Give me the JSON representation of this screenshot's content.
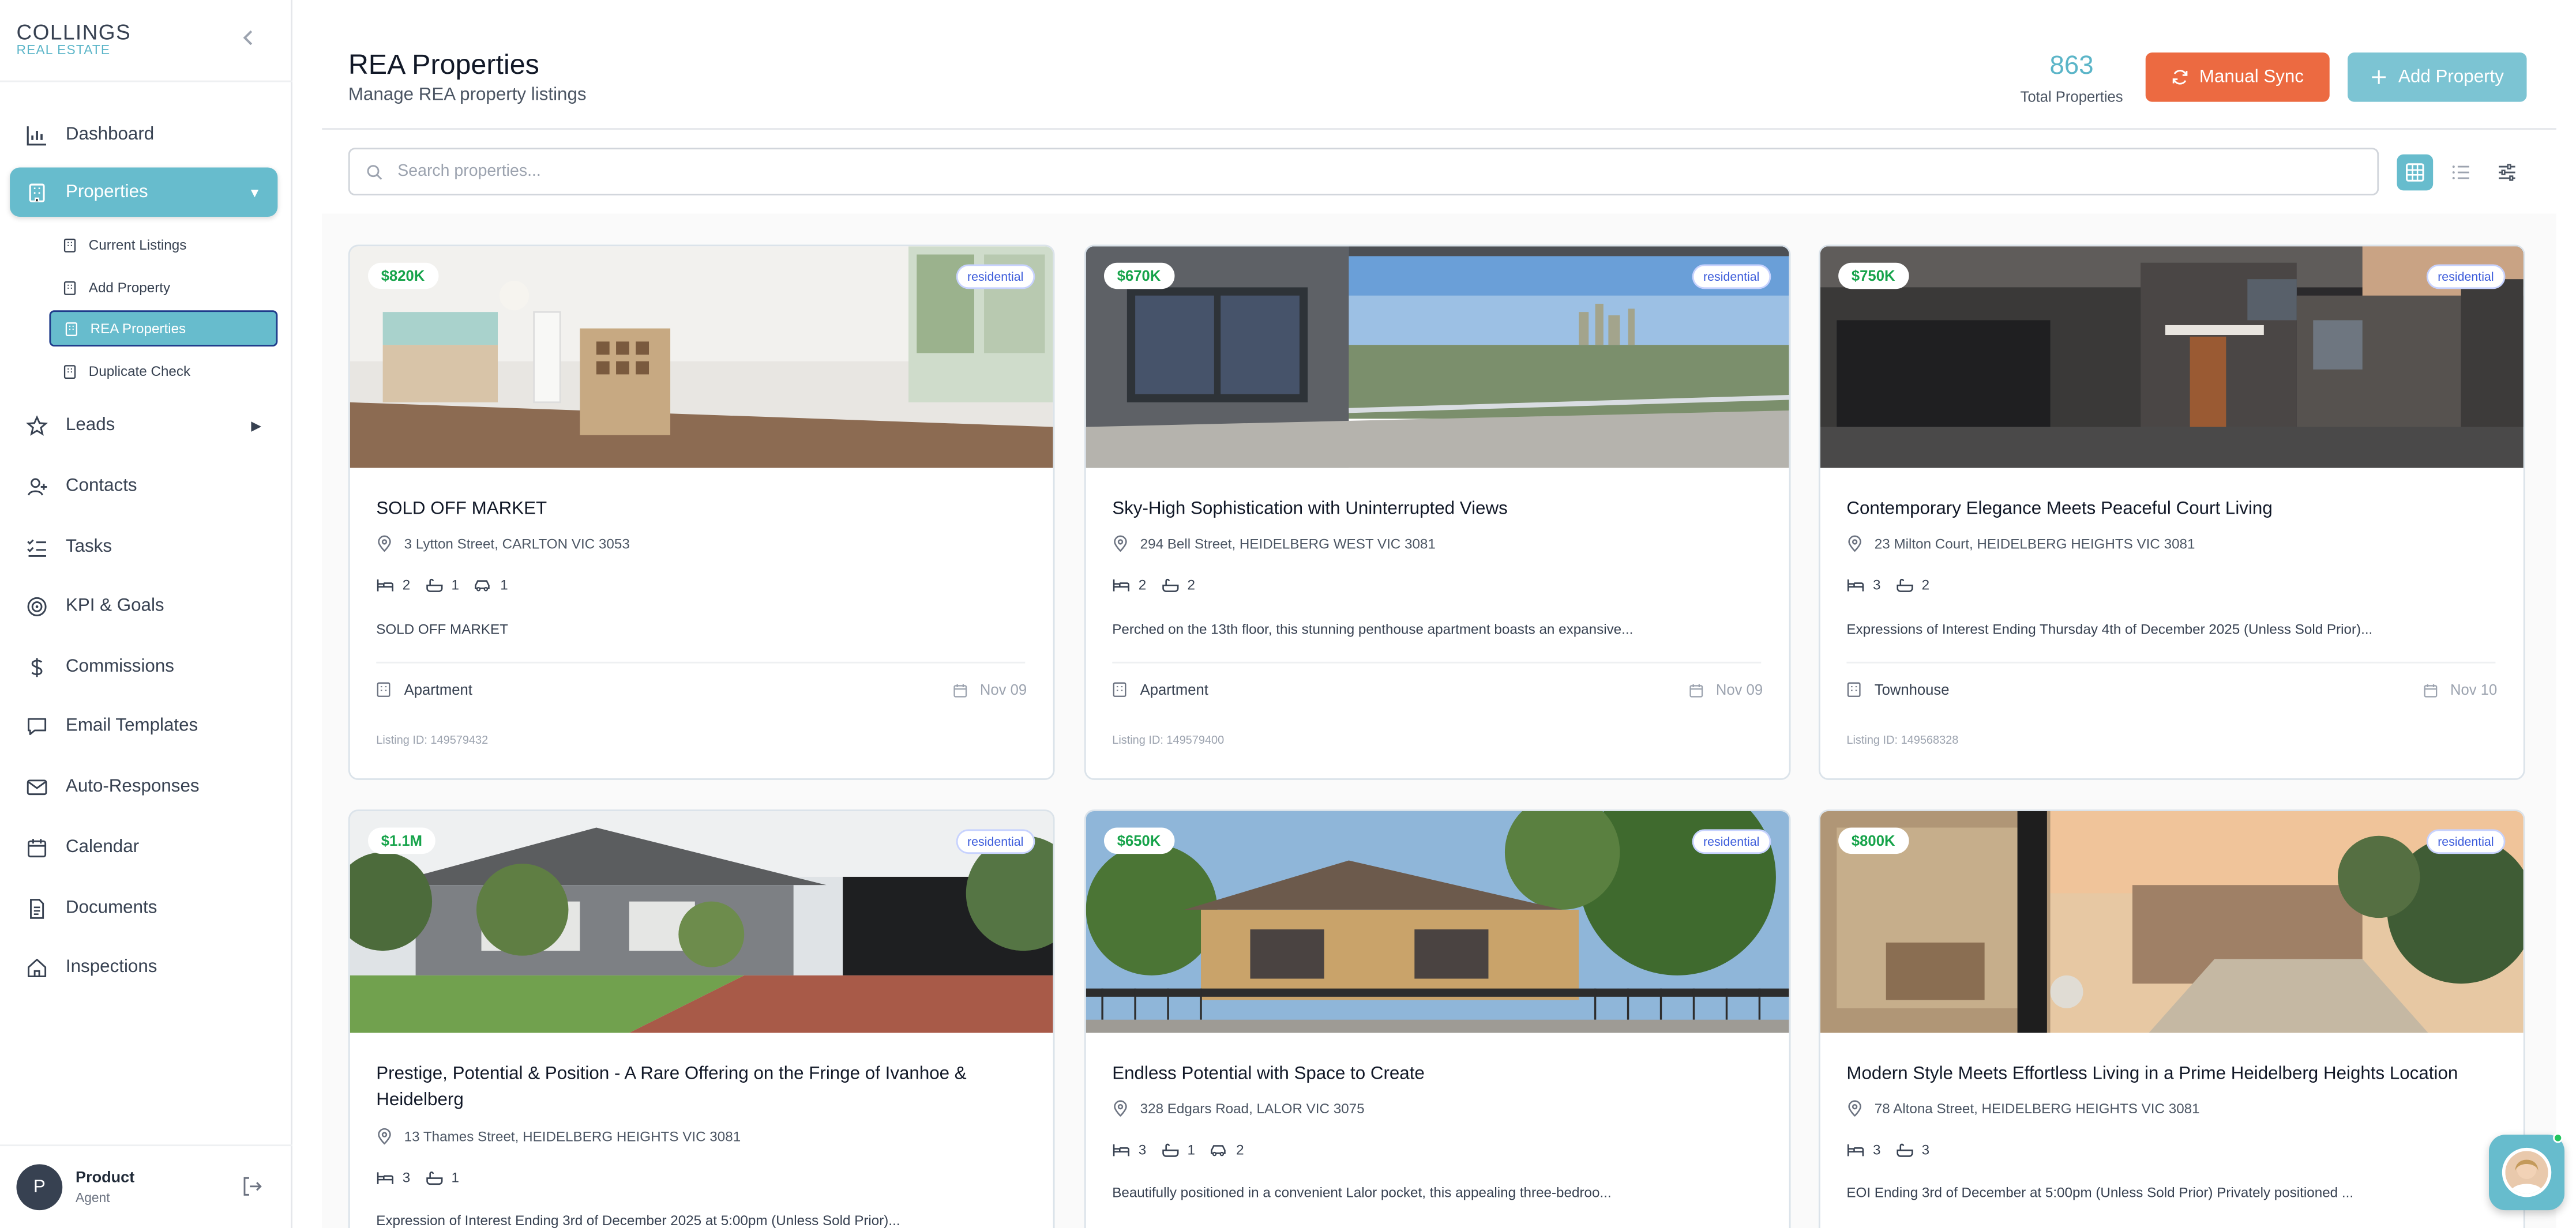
{
  "brand": {
    "name": "COLLINGS",
    "sub": "REAL ESTATE"
  },
  "sidebar": {
    "items": [
      {
        "label": "Dashboard",
        "icon": "bar-chart-icon"
      },
      {
        "label": "Properties",
        "icon": "building-icon"
      },
      {
        "label": "Leads",
        "icon": "star-icon"
      },
      {
        "label": "Contacts",
        "icon": "user-plus-icon"
      },
      {
        "label": "Tasks",
        "icon": "checklist-icon"
      },
      {
        "label": "KPI & Goals",
        "icon": "target-icon"
      },
      {
        "label": "Commissions",
        "icon": "dollar-icon"
      },
      {
        "label": "Email Templates",
        "icon": "message-icon"
      },
      {
        "label": "Auto-Responses",
        "icon": "mail-icon"
      },
      {
        "label": "Calendar",
        "icon": "calendar-icon"
      },
      {
        "label": "Documents",
        "icon": "document-icon"
      },
      {
        "label": "Inspections",
        "icon": "home-icon"
      }
    ],
    "properties_sub": [
      "Current Listings",
      "Add Property",
      "REA Properties",
      "Duplicate Check"
    ],
    "active_item": "Properties",
    "active_sub": "REA Properties"
  },
  "user": {
    "initial": "P",
    "name": "Product",
    "role": "Agent"
  },
  "header": {
    "title": "REA Properties",
    "subtitle": "Manage REA property listings",
    "count": "863",
    "count_label": "Total Properties",
    "sync_label": "Manual Sync",
    "add_label": "Add Property"
  },
  "search": {
    "placeholder": "Search properties..."
  },
  "colors": {
    "accent": "#67bccd",
    "sync": "#ec6a41",
    "price": "#16a34a"
  },
  "cards": [
    {
      "price": "$820K",
      "tag": "residential",
      "title": "SOLD OFF MARKET",
      "address": "3 Lytton Street, CARLTON VIC 3053",
      "beds": "2",
      "baths": "1",
      "cars": "1",
      "desc": "SOLD OFF MARKET",
      "type": "Apartment",
      "date": "Nov 09",
      "listing_id": "Listing ID: 149579432"
    },
    {
      "price": "$670K",
      "tag": "residential",
      "title": "Sky-High Sophistication with Uninterrupted Views",
      "address": "294 Bell Street, HEIDELBERG WEST VIC 3081",
      "beds": "2",
      "baths": "2",
      "cars": "",
      "desc": "Perched on the 13th floor, this stunning penthouse apartment boasts an expansive...",
      "type": "Apartment",
      "date": "Nov 09",
      "listing_id": "Listing ID: 149579400"
    },
    {
      "price": "$750K",
      "tag": "residential",
      "title": "Contemporary Elegance Meets Peaceful Court Living",
      "address": "23 Milton Court, HEIDELBERG HEIGHTS VIC 3081",
      "beds": "3",
      "baths": "2",
      "cars": "",
      "desc": "Expressions of Interest Ending Thursday 4th of December 2025 (Unless Sold Prior)...",
      "type": "Townhouse",
      "date": "Nov 10",
      "listing_id": "Listing ID: 149568328"
    },
    {
      "price": "$1.1M",
      "tag": "residential",
      "title": "Prestige, Potential & Position - A Rare Offering on the Fringe of Ivanhoe & Heidelberg",
      "address": "13 Thames Street, HEIDELBERG HEIGHTS VIC 3081",
      "beds": "3",
      "baths": "1",
      "cars": "",
      "desc": "Expression of Interest Ending 3rd of December 2025 at 5:00pm (Unless Sold Prior)..."
    },
    {
      "price": "$650K",
      "tag": "residential",
      "title": "Endless Potential with Space to Create",
      "address": "328 Edgars Road, LALOR VIC 3075",
      "beds": "3",
      "baths": "1",
      "cars": "2",
      "desc": "Beautifully positioned in a convenient Lalor pocket, this appealing three-bedroo..."
    },
    {
      "price": "$800K",
      "tag": "residential",
      "title": "Modern Style Meets Effortless Living in a Prime Heidelberg Heights Location",
      "address": "78 Altona Street, HEIDELBERG HEIGHTS VIC 3081",
      "beds": "3",
      "baths": "3",
      "cars": "",
      "desc": "EOI Ending 3rd of December at 5:00pm (Unless Sold Prior) Privately positioned ..."
    }
  ]
}
